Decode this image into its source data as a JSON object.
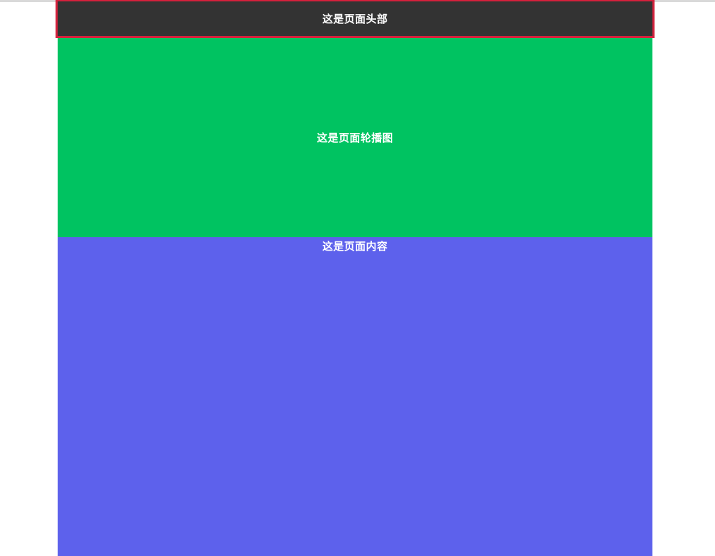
{
  "header": {
    "text": "这是页面头部",
    "background": "#333333",
    "border_color": "#d4203c"
  },
  "carousel": {
    "text": "这是页面轮播图",
    "background": "#00c361"
  },
  "content": {
    "text": "这是页面内容",
    "background": "#5d61ec"
  }
}
